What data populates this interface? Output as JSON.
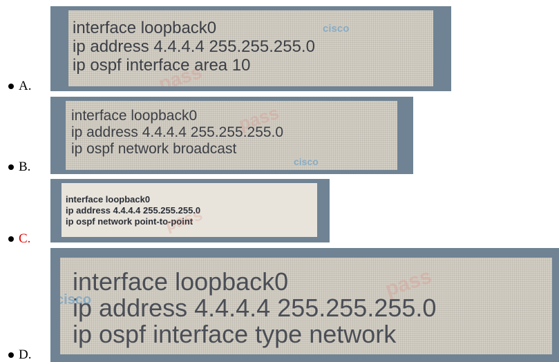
{
  "options": [
    {
      "letter": "A.",
      "correct": false,
      "lines": [
        "interface loopback0",
        "ip address 4.4.4.4 255.255.255.0",
        "ip ospf interface area 10"
      ]
    },
    {
      "letter": "B.",
      "correct": false,
      "lines": [
        "interface loopback0",
        "ip address 4.4.4.4 255.255.255.0",
        "ip ospf network broadcast"
      ]
    },
    {
      "letter": "C.",
      "correct": true,
      "lines": [
        "interface loopback0",
        "ip address 4.4.4.4 255.255.255.0",
        "ip ospf network point-to-point"
      ]
    },
    {
      "letter": "D.",
      "correct": false,
      "lines": [
        "interface loopback0",
        "ip address 4.4.4.4 255.255.255.0",
        "ip ospf interface type network"
      ]
    }
  ],
  "watermark": {
    "logo": "cisco",
    "text": "pass"
  },
  "colors": {
    "correct": "#e00000",
    "panel": "#6f8394",
    "snapshot": "#d4cfc4"
  }
}
